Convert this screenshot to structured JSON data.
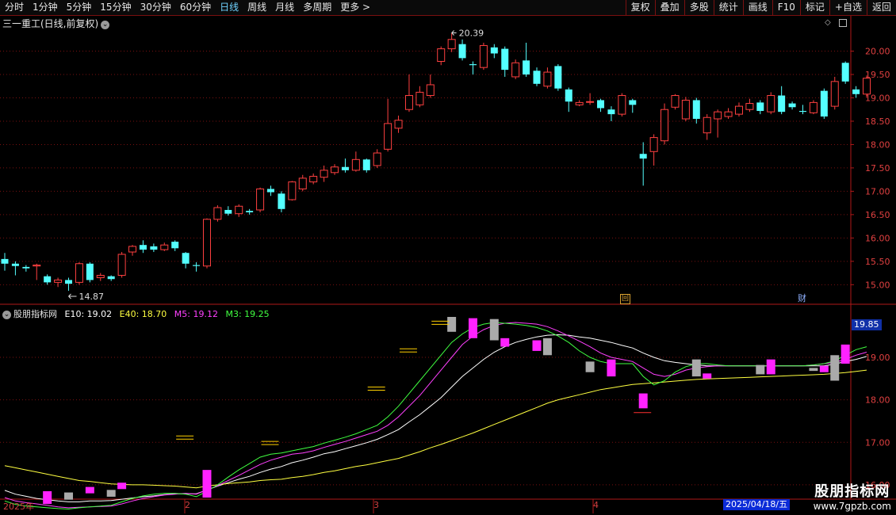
{
  "toolbar": {
    "periods": [
      "分时",
      "1分钟",
      "5分钟",
      "15分钟",
      "30分钟",
      "60分钟",
      "日线",
      "周线",
      "月线",
      "多周期",
      "更多 >"
    ],
    "active_period": "日线",
    "right_buttons": [
      "复权",
      "叠加",
      "多股",
      "统计",
      "画线",
      "F10",
      "标记",
      "+自选",
      "返回"
    ]
  },
  "chart_title": "三一重工(日线,前复权)",
  "indicator": {
    "name": "股朋指标网",
    "values": [
      {
        "label": "E10: 19.02",
        "color": "#ffffff"
      },
      {
        "label": "E40: 18.70",
        "color": "#ffff40"
      },
      {
        "label": "M5: 19.12",
        "color": "#ff40ff"
      },
      {
        "label": "M3: 19.25",
        "color": "#40ff40"
      }
    ],
    "current_value": "19.85"
  },
  "price_axis": [
    "20.00",
    "19.50",
    "19.00",
    "18.50",
    "18.00",
    "17.50",
    "17.00",
    "16.50",
    "16.00",
    "15.50",
    "15.00"
  ],
  "ind_axis": [
    "19.00",
    "18.00",
    "17.00",
    "16.00"
  ],
  "annotations": {
    "high": "20.39",
    "low": "14.87"
  },
  "markers": [
    {
      "glyph": "回"
    },
    {
      "glyph": "财"
    }
  ],
  "x_axis": [
    {
      "label": "2025年"
    },
    {
      "label": "2"
    },
    {
      "label": "3"
    },
    {
      "label": "4"
    }
  ],
  "date_badge": "2025/04/18/五",
  "watermark": {
    "name": "股朋指标网",
    "url": "www.7gpzb.com"
  },
  "colors": {
    "up": "#ff4040",
    "down": "#54ffff",
    "grid": "#7a1010",
    "axis": "#b01818"
  },
  "chart_data": [
    {
      "type": "candlestick",
      "title": "三一重工(日线,前复权)",
      "ylim": [
        14.7,
        20.45
      ],
      "candles": [
        [
          15.55,
          15.45,
          15.68,
          15.3
        ],
        [
          15.45,
          15.4,
          15.5,
          15.2
        ],
        [
          15.38,
          15.35,
          15.42,
          15.28
        ],
        [
          15.4,
          15.42,
          15.45,
          15.1
        ],
        [
          15.18,
          15.05,
          15.22,
          15.0
        ],
        [
          15.05,
          15.1,
          15.15,
          14.95
        ],
        [
          15.1,
          15.02,
          15.15,
          14.87
        ],
        [
          15.05,
          15.45,
          15.48,
          15.0
        ],
        [
          15.45,
          15.1,
          15.48,
          15.05
        ],
        [
          15.15,
          15.2,
          15.25,
          15.08
        ],
        [
          15.18,
          15.12,
          15.2,
          15.08
        ],
        [
          15.2,
          15.65,
          15.7,
          15.15
        ],
        [
          15.7,
          15.82,
          15.85,
          15.62
        ],
        [
          15.85,
          15.75,
          15.95,
          15.68
        ],
        [
          15.82,
          15.75,
          15.88,
          15.7
        ],
        [
          15.75,
          15.85,
          15.9,
          15.72
        ],
        [
          15.92,
          15.78,
          15.95,
          15.72
        ],
        [
          15.68,
          15.45,
          15.7,
          15.35
        ],
        [
          15.42,
          15.4,
          15.48,
          15.28
        ],
        [
          15.4,
          16.4,
          16.42,
          15.35
        ],
        [
          16.4,
          16.65,
          16.7,
          16.35
        ],
        [
          16.6,
          16.52,
          16.68,
          16.48
        ],
        [
          16.52,
          16.68,
          16.72,
          16.45
        ],
        [
          16.58,
          16.55,
          16.62,
          16.5
        ],
        [
          16.6,
          17.05,
          17.08,
          16.55
        ],
        [
          17.05,
          16.98,
          17.12,
          16.9
        ],
        [
          16.95,
          16.62,
          17.0,
          16.55
        ],
        [
          16.82,
          17.2,
          17.22,
          16.8
        ],
        [
          17.05,
          17.28,
          17.35,
          17.0
        ],
        [
          17.2,
          17.32,
          17.38,
          17.15
        ],
        [
          17.3,
          17.45,
          17.55,
          17.2
        ],
        [
          17.4,
          17.52,
          17.58,
          17.35
        ],
        [
          17.52,
          17.45,
          17.7,
          17.4
        ],
        [
          17.45,
          17.68,
          17.85,
          17.42
        ],
        [
          17.68,
          17.45,
          17.7,
          17.4
        ],
        [
          17.55,
          17.82,
          17.9,
          17.5
        ],
        [
          17.9,
          18.45,
          18.98,
          17.85
        ],
        [
          18.35,
          18.52,
          18.62,
          18.25
        ],
        [
          18.75,
          19.05,
          19.5,
          18.7
        ],
        [
          18.85,
          19.12,
          19.25,
          18.8
        ],
        [
          19.05,
          19.28,
          19.5,
          19.0
        ],
        [
          19.78,
          20.05,
          20.1,
          19.7
        ],
        [
          20.05,
          20.25,
          20.39,
          19.98
        ],
        [
          20.15,
          19.85,
          20.25,
          19.8
        ],
        [
          19.72,
          19.7,
          19.78,
          19.5
        ],
        [
          19.65,
          20.12,
          20.18,
          19.6
        ],
        [
          20.08,
          19.95,
          20.15,
          19.85
        ],
        [
          20.05,
          19.6,
          20.1,
          19.45
        ],
        [
          19.45,
          19.75,
          19.82,
          19.4
        ],
        [
          19.8,
          19.5,
          20.18,
          19.45
        ],
        [
          19.58,
          19.3,
          19.65,
          19.25
        ],
        [
          19.25,
          19.55,
          19.65,
          19.2
        ],
        [
          19.68,
          19.2,
          19.72,
          19.15
        ],
        [
          19.18,
          18.92,
          19.22,
          18.7
        ],
        [
          18.85,
          18.9,
          18.95,
          18.82
        ],
        [
          18.92,
          18.92,
          19.1,
          18.85
        ],
        [
          18.95,
          18.78,
          18.98,
          18.7
        ],
        [
          18.75,
          18.65,
          18.82,
          18.5
        ],
        [
          18.65,
          19.05,
          19.1,
          18.6
        ],
        [
          18.95,
          18.85,
          18.98,
          18.68
        ],
        [
          17.8,
          17.7,
          18.05,
          17.12
        ],
        [
          17.85,
          18.15,
          18.22,
          17.55
        ],
        [
          18.08,
          18.75,
          18.88,
          18.0
        ],
        [
          18.8,
          19.05,
          19.08,
          18.75
        ],
        [
          18.55,
          18.95,
          19.02,
          18.5
        ],
        [
          18.95,
          18.55,
          19.0,
          18.45
        ],
        [
          18.25,
          18.58,
          18.65,
          18.1
        ],
        [
          18.55,
          18.7,
          18.75,
          18.15
        ],
        [
          18.6,
          18.7,
          18.78,
          18.55
        ],
        [
          18.65,
          18.82,
          18.9,
          18.6
        ],
        [
          18.75,
          18.88,
          18.98,
          18.7
        ],
        [
          18.9,
          18.72,
          18.95,
          18.65
        ],
        [
          18.7,
          19.05,
          19.12,
          18.65
        ],
        [
          19.05,
          18.7,
          19.25,
          18.65
        ],
        [
          18.88,
          18.8,
          18.92,
          18.75
        ],
        [
          18.72,
          18.7,
          18.85,
          18.65
        ],
        [
          18.68,
          18.9,
          18.95,
          18.65
        ],
        [
          19.15,
          18.6,
          19.2,
          18.55
        ],
        [
          18.82,
          19.35,
          19.45,
          18.75
        ],
        [
          19.75,
          19.35,
          19.78,
          19.3
        ],
        [
          19.18,
          19.08,
          19.25,
          19.0
        ],
        [
          19.08,
          19.42,
          19.48,
          19.0
        ]
      ]
    },
    {
      "type": "line",
      "title": "股朋指标网",
      "ylim": [
        15.7,
        19.95
      ],
      "series": [
        {
          "name": "E10",
          "color": "#ffffff",
          "values": [
            15.87,
            15.78,
            15.73,
            15.68,
            15.65,
            15.62,
            15.6,
            15.6,
            15.62,
            15.62,
            15.63,
            15.66,
            15.69,
            15.72,
            15.74,
            15.77,
            15.79,
            15.79,
            15.79,
            15.88,
            15.97,
            16.05,
            16.13,
            16.2,
            16.29,
            16.37,
            16.43,
            16.52,
            16.58,
            16.65,
            16.73,
            16.78,
            16.85,
            16.92,
            16.99,
            17.07,
            17.18,
            17.3,
            17.48,
            17.65,
            17.85,
            18.05,
            18.3,
            18.55,
            18.75,
            18.95,
            19.12,
            19.25,
            19.35,
            19.42,
            19.48,
            19.52,
            19.53,
            19.52,
            19.48,
            19.45,
            19.4,
            19.35,
            19.28,
            19.22,
            19.1,
            19.0,
            18.92,
            18.88,
            18.85,
            18.82,
            18.8,
            18.8,
            18.8,
            18.8,
            18.8,
            18.8,
            18.8,
            18.8,
            18.8,
            18.8,
            18.8,
            18.8,
            18.84,
            18.9,
            18.95,
            19.02
          ]
        },
        {
          "name": "E40",
          "color": "#ffff40",
          "values": [
            16.45,
            16.4,
            16.35,
            16.3,
            16.25,
            16.2,
            16.15,
            16.1,
            16.08,
            16.05,
            16.02,
            16.01,
            16.0,
            16.0,
            15.99,
            15.98,
            15.97,
            15.95,
            15.93,
            15.97,
            16.0,
            16.03,
            16.05,
            16.07,
            16.1,
            16.12,
            16.13,
            16.17,
            16.2,
            16.24,
            16.29,
            16.33,
            16.38,
            16.43,
            16.47,
            16.52,
            16.57,
            16.62,
            16.7,
            16.78,
            16.87,
            16.95,
            17.04,
            17.13,
            17.22,
            17.32,
            17.42,
            17.52,
            17.62,
            17.72,
            17.82,
            17.92,
            18.0,
            18.06,
            18.12,
            18.18,
            18.24,
            18.28,
            18.32,
            18.36,
            18.38,
            18.4,
            18.42,
            18.44,
            18.46,
            18.48,
            18.49,
            18.5,
            18.51,
            18.52,
            18.53,
            18.54,
            18.55,
            18.56,
            18.57,
            18.58,
            18.59,
            18.6,
            18.62,
            18.64,
            18.67,
            18.7
          ]
        },
        {
          "name": "M5",
          "color": "#ff40ff",
          "values": [
            15.7,
            15.62,
            15.58,
            15.55,
            15.52,
            15.48,
            15.46,
            15.47,
            15.48,
            15.49,
            15.5,
            15.55,
            15.62,
            15.68,
            15.72,
            15.76,
            15.78,
            15.8,
            15.78,
            15.88,
            15.98,
            16.1,
            16.22,
            16.35,
            16.48,
            16.58,
            16.65,
            16.72,
            16.75,
            16.8,
            16.88,
            16.95,
            17.02,
            17.1,
            17.18,
            17.26,
            17.4,
            17.6,
            17.85,
            18.1,
            18.4,
            18.7,
            19.0,
            19.3,
            19.5,
            19.65,
            19.75,
            19.8,
            19.82,
            19.8,
            19.78,
            19.72,
            19.62,
            19.5,
            19.38,
            19.25,
            19.1,
            19.0,
            18.95,
            18.9,
            18.75,
            18.6,
            18.55,
            18.6,
            18.7,
            18.75,
            18.78,
            18.8,
            18.8,
            18.8,
            18.8,
            18.8,
            18.8,
            18.8,
            18.8,
            18.8,
            18.82,
            18.85,
            18.88,
            18.95,
            19.05,
            19.12
          ]
        },
        {
          "name": "M3",
          "color": "#40ff40",
          "values": [
            15.62,
            15.54,
            15.5,
            15.48,
            15.46,
            15.44,
            15.43,
            15.46,
            15.48,
            15.5,
            15.52,
            15.6,
            15.68,
            15.74,
            15.78,
            15.8,
            15.8,
            15.78,
            15.72,
            15.85,
            16.0,
            16.18,
            16.35,
            16.5,
            16.65,
            16.72,
            16.75,
            16.8,
            16.85,
            16.9,
            16.98,
            17.05,
            17.12,
            17.2,
            17.3,
            17.4,
            17.6,
            17.85,
            18.15,
            18.45,
            18.75,
            19.05,
            19.35,
            19.55,
            19.7,
            19.78,
            19.82,
            19.8,
            19.78,
            19.75,
            19.7,
            19.62,
            19.5,
            19.35,
            19.15,
            19.0,
            18.9,
            18.85,
            18.85,
            18.85,
            18.55,
            18.35,
            18.45,
            18.65,
            18.78,
            18.85,
            18.85,
            18.82,
            18.8,
            18.8,
            18.8,
            18.8,
            18.8,
            18.8,
            18.8,
            18.8,
            18.82,
            18.85,
            18.92,
            19.05,
            19.18,
            19.25
          ]
        }
      ],
      "bars": [
        {
          "i": 4,
          "c": "#ff22ff",
          "a": 15.85,
          "b": 15.55
        },
        {
          "i": 6,
          "c": "#aaaaaa",
          "a": 15.82,
          "b": 15.65
        },
        {
          "i": 8,
          "c": "#ff22ff",
          "a": 15.95,
          "b": 15.8
        },
        {
          "i": 10,
          "c": "#aaaaaa",
          "a": 15.88,
          "b": 15.72
        },
        {
          "i": 11,
          "c": "#ff22ff",
          "a": 16.05,
          "b": 15.9
        },
        {
          "i": 19,
          "c": "#ff22ff",
          "a": 16.35,
          "b": 15.7
        },
        {
          "i": 42,
          "c": "#aaaaaa",
          "a": 19.95,
          "b": 19.6
        },
        {
          "i": 44,
          "c": "#ff22ff",
          "a": 19.92,
          "b": 19.45
        },
        {
          "i": 46,
          "c": "#aaaaaa",
          "a": 19.9,
          "b": 19.4
        },
        {
          "i": 47,
          "c": "#ff22ff",
          "a": 19.45,
          "b": 19.25
        },
        {
          "i": 50,
          "c": "#ff22ff",
          "a": 19.4,
          "b": 19.15
        },
        {
          "i": 51,
          "c": "#aaaaaa",
          "a": 19.45,
          "b": 19.05
        },
        {
          "i": 55,
          "c": "#aaaaaa",
          "a": 18.9,
          "b": 18.65
        },
        {
          "i": 57,
          "c": "#ff22ff",
          "a": 18.95,
          "b": 18.55
        },
        {
          "i": 60,
          "c": "#ff22ff",
          "a": 18.15,
          "b": 17.8
        },
        {
          "i": 65,
          "c": "#aaaaaa",
          "a": 18.95,
          "b": 18.55
        },
        {
          "i": 66,
          "c": "#ff22ff",
          "a": 18.62,
          "b": 18.5
        },
        {
          "i": 71,
          "c": "#aaaaaa",
          "a": 18.82,
          "b": 18.6
        },
        {
          "i": 72,
          "c": "#ff22ff",
          "a": 18.95,
          "b": 18.6
        },
        {
          "i": 76,
          "c": "#aaaaaa",
          "a": 18.75,
          "b": 18.68
        },
        {
          "i": 77,
          "c": "#ff22ff",
          "a": 18.8,
          "b": 18.65
        },
        {
          "i": 78,
          "c": "#aaaaaa",
          "a": 19.05,
          "b": 18.45
        },
        {
          "i": 79,
          "c": "#ff22ff",
          "a": 19.3,
          "b": 18.85
        }
      ],
      "flags": [
        {
          "i": 17,
          "c": "#ffd000",
          "y": 17.15
        },
        {
          "i": 25,
          "c": "#ffd000",
          "y": 17.02
        },
        {
          "i": 35,
          "c": "#ffd000",
          "y": 18.3
        },
        {
          "i": 38,
          "c": "#ffd000",
          "y": 19.2
        },
        {
          "i": 41,
          "c": "#ffd000",
          "y": 19.85
        },
        {
          "i": 60,
          "c": "#ff3030",
          "y": 17.7
        }
      ]
    }
  ]
}
